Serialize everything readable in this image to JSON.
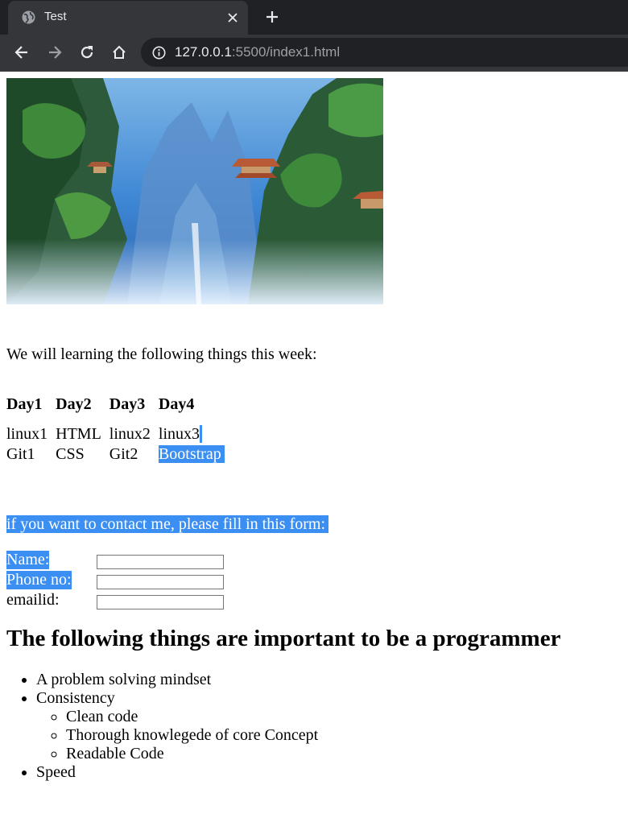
{
  "browser": {
    "tab_title": "Test",
    "url_host": "127.0.0.1",
    "url_rest": ":5500/index1.html"
  },
  "page": {
    "intro": "We will learning the following things this week:",
    "schedule": {
      "headers": [
        "Day1",
        "Day2",
        "Day3",
        "Day4"
      ],
      "rows": [
        [
          "linux1",
          "HTML",
          "linux2",
          "linux3"
        ],
        [
          "Git1",
          "CSS",
          "Git2",
          "Bootstrap"
        ]
      ]
    },
    "contact_prompt": "if you want to contact me, please fill in this form:",
    "form": {
      "name_label": "Name:",
      "phone_label": "Phone no:",
      "email_label": "emailid:",
      "name_value": "",
      "phone_value": "",
      "email_value": ""
    },
    "heading": "The following things are important to be a programmer",
    "list": {
      "item1": "A problem solving mindset",
      "item2": "Consistency",
      "sub1": "Clean code",
      "sub2": "Thorough knowlegede of core Concept",
      "sub3": "Readable Code",
      "item3": "Speed"
    }
  },
  "colors": {
    "selection": "#3b8ff2",
    "chrome_dark": "#202124",
    "chrome_toolbar": "#35363a"
  },
  "icons": [
    "globe-icon",
    "close-icon",
    "plus-icon",
    "back-arrow-icon",
    "forward-arrow-icon",
    "reload-icon",
    "home-icon",
    "info-icon"
  ]
}
